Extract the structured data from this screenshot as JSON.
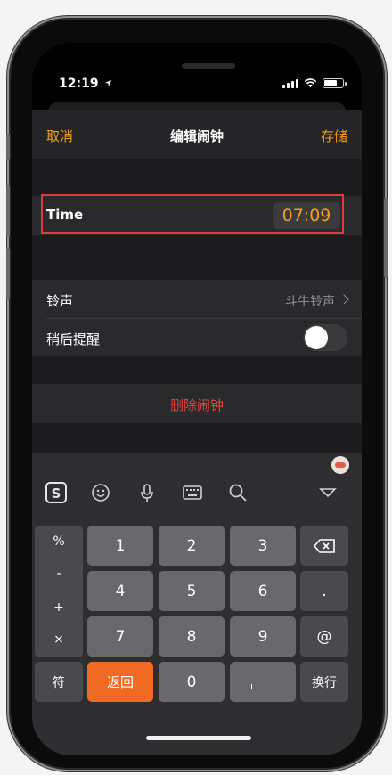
{
  "status_bar": {
    "time": "12:19"
  },
  "nav": {
    "cancel": "取消",
    "title": "编辑闹钟",
    "save": "存储"
  },
  "time_row": {
    "label": "Time",
    "value": "07:09"
  },
  "settings": {
    "ringtone_label": "铃声",
    "ringtone_value": "斗牛铃声",
    "snooze_label": "稍后提醒",
    "snooze_on": false
  },
  "delete_label": "删除闹钟",
  "keyboard": {
    "symbols": [
      "%",
      "-",
      "+",
      "×"
    ],
    "digits": [
      "1",
      "2",
      "3",
      "4",
      "5",
      "6",
      "7",
      "8",
      "9",
      "0"
    ],
    "dot": ".",
    "at": "@",
    "fu": "符",
    "back": "返回",
    "newline": "换行",
    "toolbar_icons": [
      "sogou-logo-icon",
      "emoji-icon",
      "microphone-icon",
      "keyboard-icon",
      "search-icon",
      "collapse-icon"
    ]
  },
  "colors": {
    "accent": "#f39c1e",
    "delete": "#e5433a",
    "return_key": "#f06a23",
    "highlight": "#e03a3a"
  }
}
